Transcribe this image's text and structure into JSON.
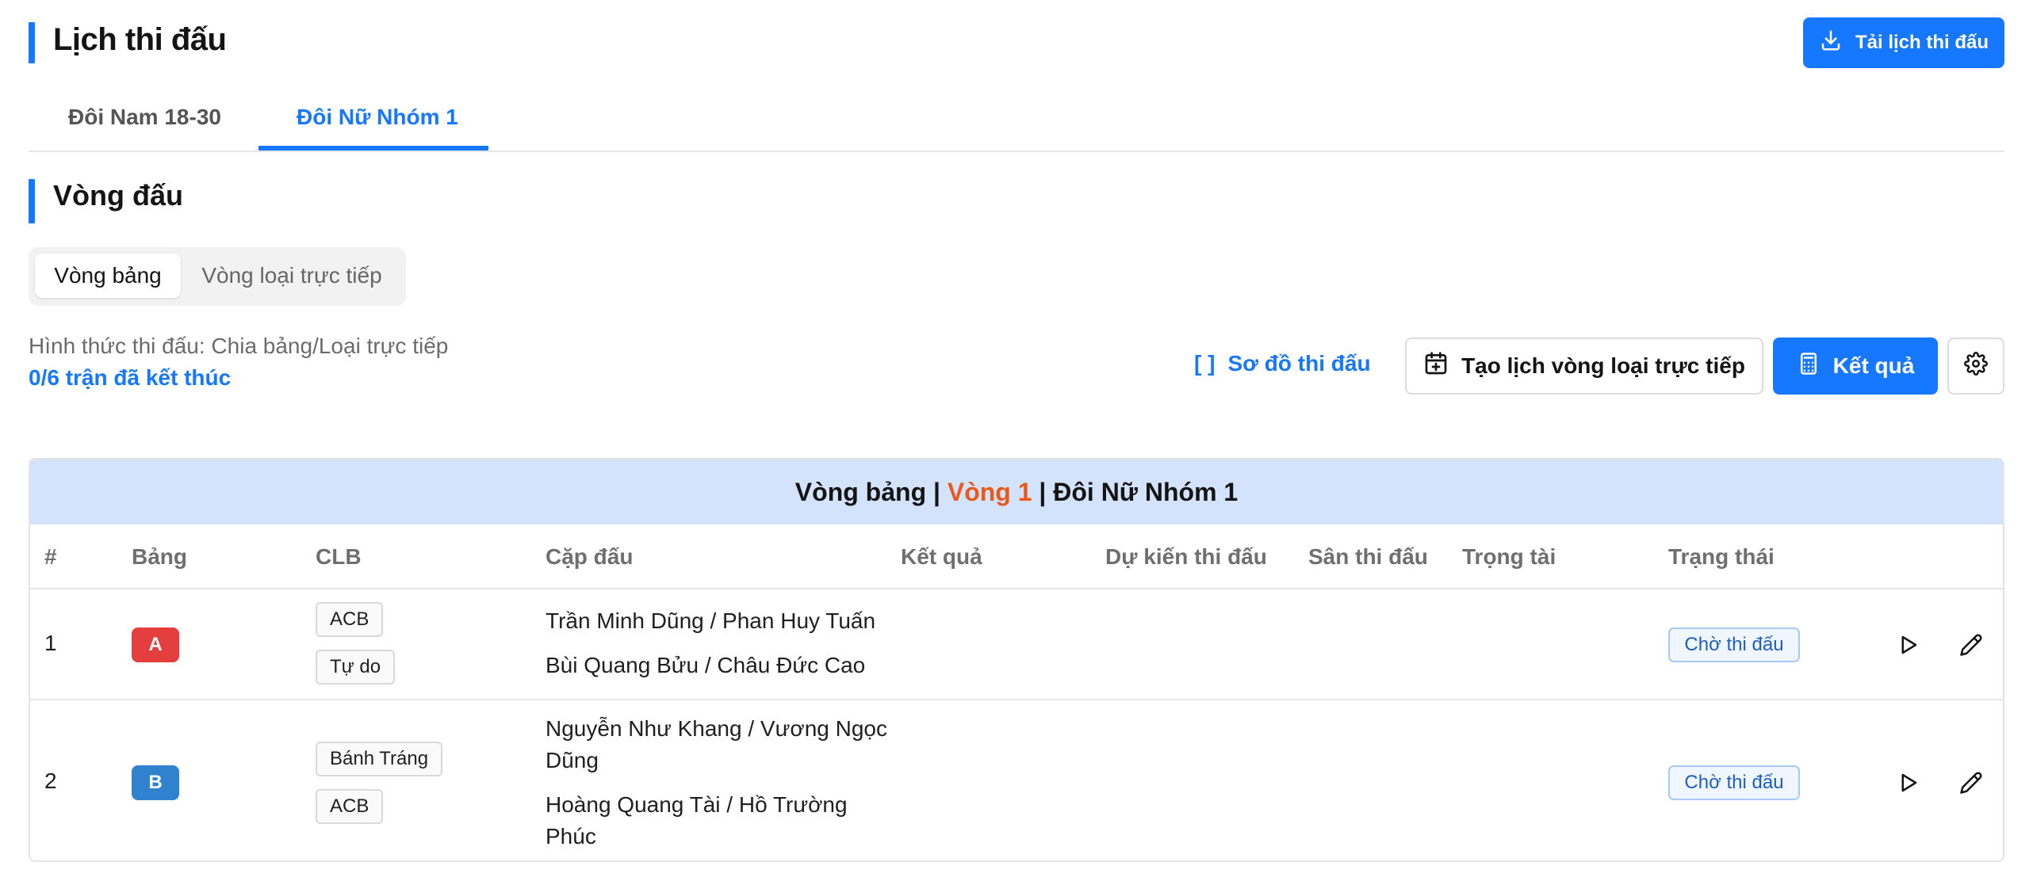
{
  "header": {
    "title": "Lịch thi đấu",
    "download_label": "Tải lịch thi đấu"
  },
  "tabs": [
    {
      "label": "Đôi Nam 18-30",
      "active": false
    },
    {
      "label": "Đôi Nữ Nhóm 1",
      "active": true
    }
  ],
  "section": {
    "title": "Vòng đấu",
    "segments": [
      {
        "label": "Vòng bảng",
        "active": true
      },
      {
        "label": "Vòng loại trực tiếp",
        "active": false
      }
    ],
    "format_text": "Hình thức thi đấu: Chia bảng/Loại trực tiếp",
    "progress_text": "0/6 trận đã kết thúc"
  },
  "actions": {
    "bracket_icon": "[ ]",
    "bracket_label": "Sơ đồ thi đấu",
    "create_label": "Tạo lịch vòng loại trực tiếp",
    "result_label": "Kết quả"
  },
  "table": {
    "caption": {
      "stage": "Vòng bảng",
      "sep1": " | ",
      "round": "Vòng 1",
      "sep2": " | ",
      "group": "Đôi Nữ Nhóm 1"
    },
    "columns": [
      "#",
      "Bảng",
      "CLB",
      "Cặp đấu",
      "Kết quả",
      "Dự kiến thi đấu",
      "Sân thi đấu",
      "Trọng tài",
      "Trạng thái"
    ],
    "rows": [
      {
        "index": "1",
        "group": "A",
        "clubs": [
          "ACB",
          "Tự do"
        ],
        "pairs": [
          "Trần Minh Dũng / Phan Huy Tuấn",
          "Bùi Quang Bửu / Châu Đức Cao"
        ],
        "status": "Chờ thi đấu"
      },
      {
        "index": "2",
        "group": "B",
        "clubs": [
          "Bánh Tráng",
          "ACB"
        ],
        "pairs": [
          "Nguyễn Như Khang / Vương Ngọc Dũng",
          "Hoàng Quang Tài / Hồ Trường Phúc"
        ],
        "status": "Chờ thi đấu"
      }
    ]
  },
  "colors": {
    "primary": "#1677ff",
    "caption_bg": "#d4e3fc",
    "round_orange": "#e8591a",
    "group_a": "#e53e3e",
    "group_b": "#3182ce"
  }
}
